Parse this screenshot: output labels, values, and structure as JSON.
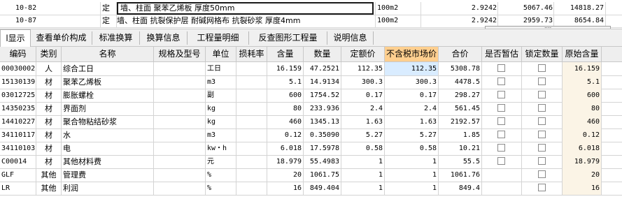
{
  "top_rows": [
    {
      "code": "10-82",
      "type": "定",
      "desc": "墙、柱面 聚苯乙烯板 厚度50mm",
      "unit": "100m2",
      "qty": "2.9242",
      "price": "5067.46",
      "total": "14818.27",
      "selected": true
    },
    {
      "code": "10-87",
      "type": "定",
      "desc": "墙、柱面 抗裂保护层 耐碱网格布 抗裂砂浆 厚度4mm",
      "unit": "100m2",
      "qty": "2.9242",
      "price": "2959.73",
      "total": "8654.84",
      "selected": false
    }
  ],
  "top_scroll_dots": "....",
  "tabs": [
    "l显示",
    "查看单价构成",
    "标准换算",
    "换算信息",
    "工程量明细",
    "反查图形工程量",
    "说明信息"
  ],
  "active_tab": 0,
  "columns": [
    "编码",
    "类别",
    "名称",
    "规格及型号",
    "单位",
    "损耗率",
    "含量",
    "数量",
    "定额价",
    "不含税市场价",
    "合价",
    "是否暂估",
    "锁定数量",
    "原始含量"
  ],
  "rows": [
    {
      "code": "00030002",
      "cat": "人",
      "name": "综合工日",
      "spec": "",
      "unit": "工日",
      "loss": "",
      "content": "16.159",
      "qty": "47.2521",
      "quota": "112.35",
      "market": "112.35",
      "total": "5308.78",
      "est": false,
      "lock": false,
      "orig": "16.159"
    },
    {
      "code": "15130139",
      "cat": "材",
      "name": "聚苯乙烯板",
      "spec": "",
      "unit": "m3",
      "loss": "",
      "content": "5.1",
      "qty": "14.9134",
      "quota": "300.3",
      "market": "300.3",
      "total": "4478.5",
      "est": false,
      "lock": false,
      "orig": "5.1"
    },
    {
      "code": "03012725",
      "cat": "材",
      "name": "膨胀螺栓",
      "spec": "",
      "unit": "副",
      "loss": "",
      "content": "600",
      "qty": "1754.52",
      "quota": "0.17",
      "market": "0.17",
      "total": "298.27",
      "est": false,
      "lock": false,
      "orig": "600"
    },
    {
      "code": "14350235",
      "cat": "材",
      "name": "界面剂",
      "spec": "",
      "unit": "kg",
      "loss": "",
      "content": "80",
      "qty": "233.936",
      "quota": "2.4",
      "market": "2.4",
      "total": "561.45",
      "est": false,
      "lock": false,
      "orig": "80"
    },
    {
      "code": "14410227",
      "cat": "材",
      "name": "聚合物粘结砂浆",
      "spec": "",
      "unit": "kg",
      "loss": "",
      "content": "460",
      "qty": "1345.13",
      "quota": "1.63",
      "market": "1.63",
      "total": "2192.57",
      "est": false,
      "lock": false,
      "orig": "460"
    },
    {
      "code": "34110117",
      "cat": "材",
      "name": "水",
      "spec": "",
      "unit": "m3",
      "loss": "",
      "content": "0.12",
      "qty": "0.35090",
      "quota": "5.27",
      "market": "5.27",
      "total": "1.85",
      "est": false,
      "lock": false,
      "orig": "0.12"
    },
    {
      "code": "34110103",
      "cat": "材",
      "name": "电",
      "spec": "",
      "unit": "kw・h",
      "loss": "",
      "content": "6.018",
      "qty": "17.5978",
      "quota": "0.58",
      "market": "0.58",
      "total": "10.21",
      "est": false,
      "lock": false,
      "orig": "6.018"
    },
    {
      "code": "C00014",
      "cat": "材",
      "name": "其他材料费",
      "spec": "",
      "unit": "元",
      "loss": "",
      "content": "18.979",
      "qty": "55.4983",
      "quota": "1",
      "market": "1",
      "total": "55.5",
      "est": false,
      "lock": false,
      "orig": "18.979"
    },
    {
      "code": "GLF",
      "cat": "其他",
      "name": "管理费",
      "spec": "",
      "unit": "%",
      "loss": "",
      "content": "20",
      "qty": "1061.75",
      "quota": "1",
      "market": "1",
      "total": "1061.76",
      "est": null,
      "lock": false,
      "orig": "20"
    },
    {
      "code": "LR",
      "cat": "其他",
      "name": "利润",
      "spec": "",
      "unit": "%",
      "loss": "",
      "content": "16",
      "qty": "849.404",
      "quota": "1",
      "market": "1",
      "total": "849.4",
      "est": null,
      "lock": false,
      "orig": "16"
    }
  ],
  "colors": {
    "highlight_header": "#ffcf8f",
    "highlight_cell": "#d9ecff",
    "orig_col_bg": "#fbf4e6",
    "header_bg": "#eeeeee"
  }
}
